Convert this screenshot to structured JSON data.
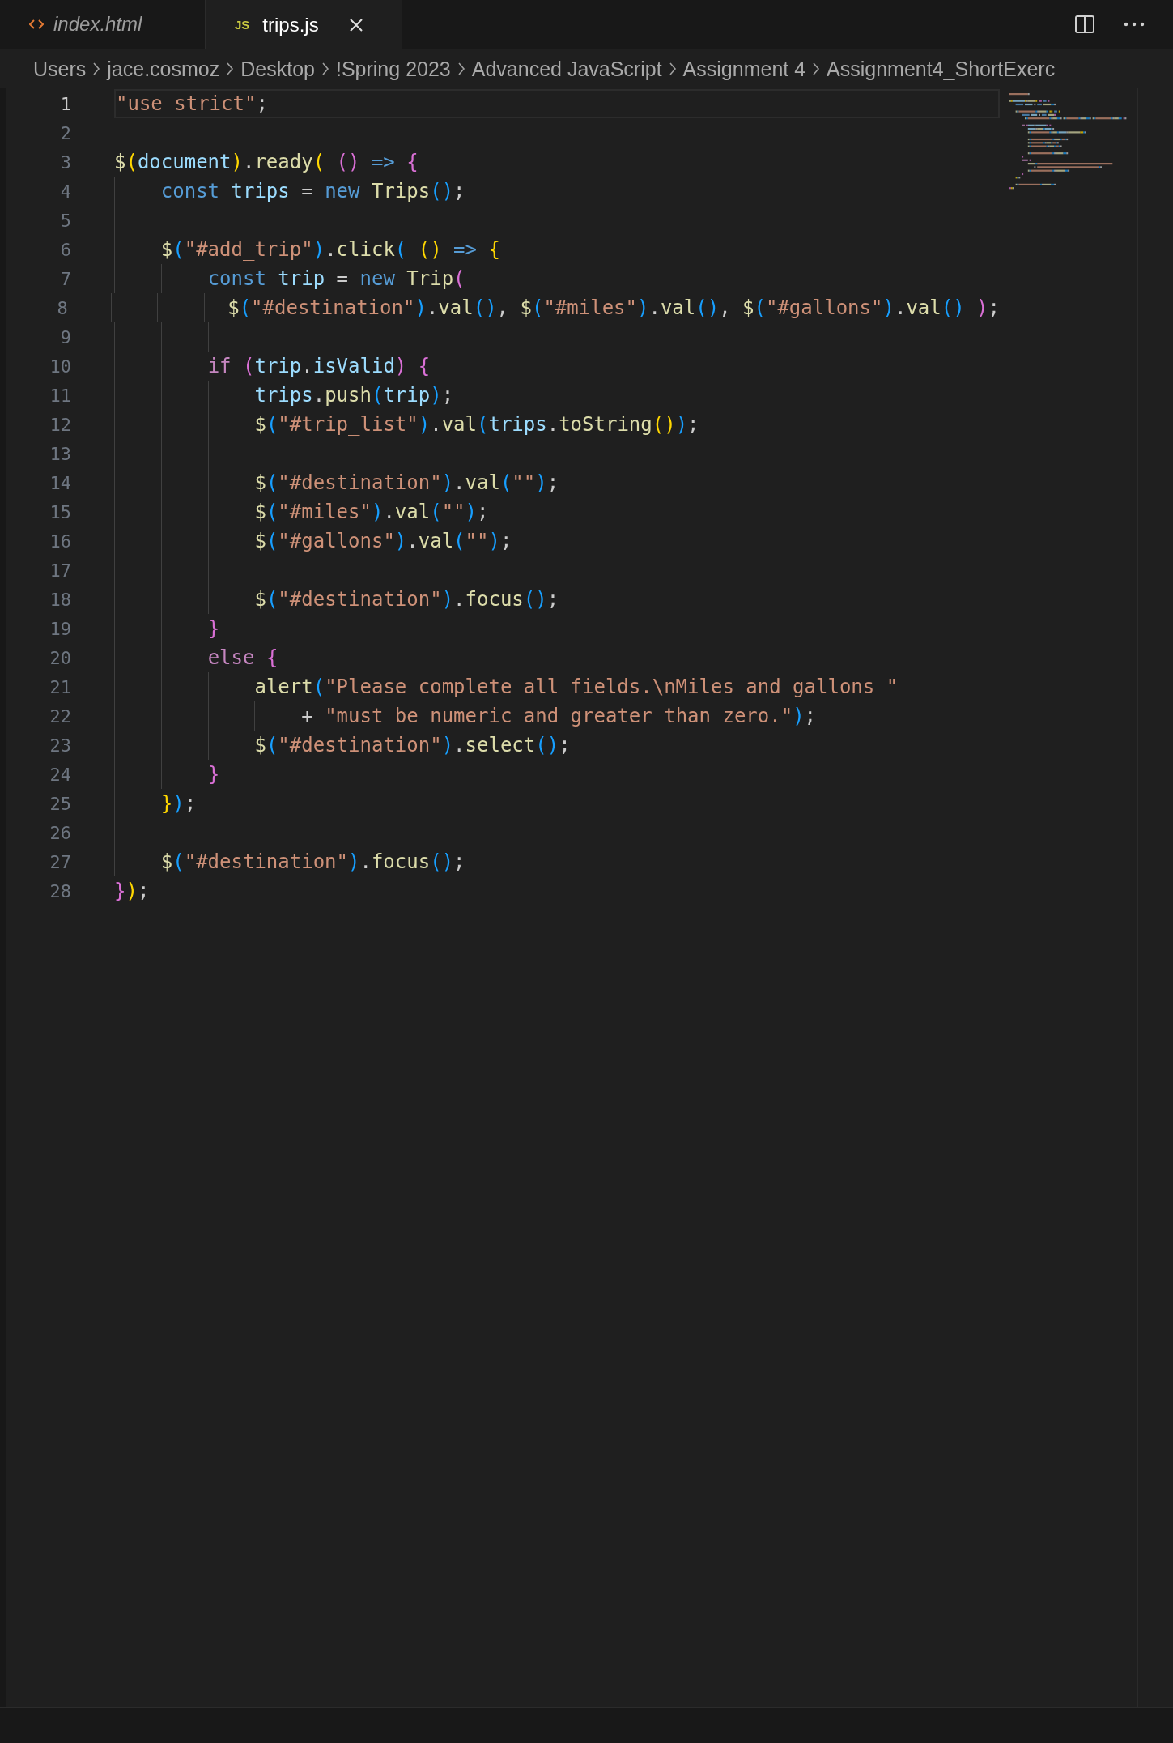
{
  "tabs": [
    {
      "label": "index.html",
      "kind": "html",
      "selected": false,
      "preview": true
    },
    {
      "label": "trips.js",
      "kind": "script",
      "badge": "JS",
      "selected": true,
      "preview": false
    }
  ],
  "breadcrumbs": [
    "Users",
    "jace.cosmoz",
    "Desktop",
    "!Spring 2023",
    "Advanced JavaScript",
    "Assignment 4",
    "Assignment4_ShortExerc"
  ],
  "code": {
    "lines": [
      {
        "number": "1",
        "current": true,
        "text": "\"use strict\";"
      },
      {
        "number": "2",
        "current": false
      },
      {
        "number": "3",
        "current": false,
        "text": "$(document).ready( () => {"
      },
      {
        "number": "4",
        "current": false,
        "text": "    const trips = new Trips();"
      },
      {
        "number": "5",
        "current": false
      },
      {
        "number": "6",
        "current": false,
        "text": "    $(\"#add_trip\").click( () => {"
      },
      {
        "number": "7",
        "current": false,
        "text": "        const trip = new Trip("
      },
      {
        "number": "8",
        "current": false,
        "text": "          $(\"#destination\").val(), $(\"#miles\").val(), $(\"#gallons\").val() );"
      },
      {
        "number": "9",
        "current": false
      },
      {
        "number": "10",
        "current": false,
        "text": "        if (trip.isValid) {"
      },
      {
        "number": "11",
        "current": false,
        "text": "            trips.push(trip);"
      },
      {
        "number": "12",
        "current": false,
        "text": "            $(\"#trip_list\").val(trips.toString());"
      },
      {
        "number": "13",
        "current": false
      },
      {
        "number": "14",
        "current": false,
        "text": "            $(\"#destination\").val(\"\");"
      },
      {
        "number": "15",
        "current": false,
        "text": "            $(\"#miles\").val(\"\");"
      },
      {
        "number": "16",
        "current": false,
        "text": "            $(\"#gallons\").val(\"\");"
      },
      {
        "number": "17",
        "current": false
      },
      {
        "number": "18",
        "current": false,
        "text": "            $(\"#destination\").focus();"
      },
      {
        "number": "19",
        "current": false,
        "text": "        }"
      },
      {
        "number": "20",
        "current": false,
        "text": "        else {"
      },
      {
        "number": "21",
        "current": false,
        "text": "            alert(\"Please complete all fields.\\nMiles and gallons \""
      },
      {
        "number": "22",
        "current": false,
        "text": "                + \"must be numeric and greater than zero.\");"
      },
      {
        "number": "23",
        "current": false,
        "text": "            $(\"#destination\").select();"
      },
      {
        "number": "24",
        "current": false,
        "text": "        }"
      },
      {
        "number": "25",
        "current": false,
        "text": "    });"
      },
      {
        "number": "26",
        "current": false
      },
      {
        "number": "27",
        "current": false,
        "text": "    $(\"#destination\").focus();"
      },
      {
        "number": "28",
        "current": false,
        "text": "});"
      }
    ]
  }
}
